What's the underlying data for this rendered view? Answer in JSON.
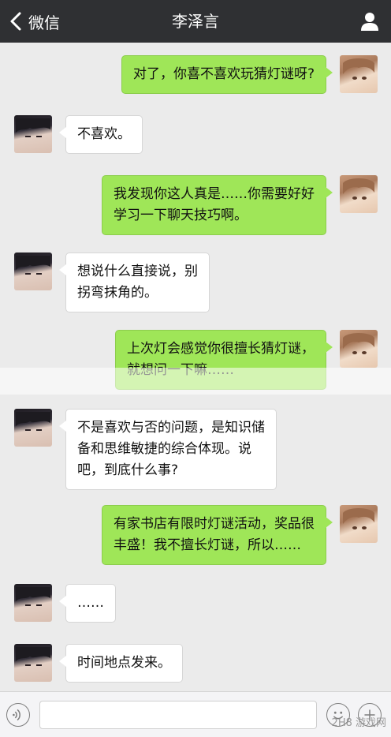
{
  "header": {
    "back_label": "微信",
    "title": "李泽言"
  },
  "messages": [
    {
      "sender": "me",
      "text": "对了，你喜不喜欢玩猜灯谜呀?"
    },
    {
      "sender": "him",
      "text": "不喜欢。"
    },
    {
      "sender": "me",
      "text": "我发现你这人真是……你需要好好\n学习一下聊天技巧啊。"
    },
    {
      "sender": "him",
      "text": "想说什么直接说，别\n拐弯抹角的。"
    },
    {
      "sender": "me",
      "text": "上次灯会感觉你很擅长猜灯谜，\n就想问一下嘛……"
    },
    {
      "sender": "him",
      "text": "不是喜欢与否的问题，是知识储\n备和思维敏捷的综合体现。说\n吧，到底什么事?"
    },
    {
      "sender": "me",
      "text": "有家书店有限时灯谜活动，奖品很\n丰盛！我不擅长灯谜，所以……"
    },
    {
      "sender": "him",
      "text": "……"
    },
    {
      "sender": "him",
      "text": "时间地点发来。"
    }
  ],
  "input_bar": {
    "placeholder": "",
    "icons": [
      "voice-icon",
      "emoji-icon",
      "plus-icon"
    ]
  },
  "watermark": "2H8 游戏网",
  "colors": {
    "topbar": "#2f3033",
    "background": "#ebebeb",
    "my_bubble": "#9fe658",
    "his_bubble": "#ffffff"
  }
}
